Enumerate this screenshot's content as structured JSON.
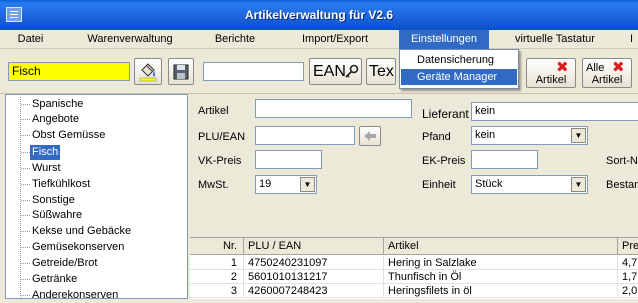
{
  "window": {
    "title": "Artikelverwaltung für V2.6"
  },
  "menu": [
    {
      "label": "Datei"
    },
    {
      "label": "Warenverwaltung"
    },
    {
      "label": "Berichte"
    },
    {
      "label": "Import/Export"
    },
    {
      "label": "Einstellungen"
    },
    {
      "label": "virtuelle Tastatur"
    },
    {
      "label": "I"
    }
  ],
  "dropdown": [
    {
      "label": "Datensicherung"
    },
    {
      "label": "Geräte Manager"
    }
  ],
  "toolbar": {
    "search_value": "Fisch",
    "ean_label": "EAN",
    "text_label": "Tex",
    "delete_article_label": "Artikel",
    "delete_all_label_1": "Alle",
    "delete_all_label_2": "Artikel"
  },
  "tree": {
    "items": [
      {
        "label": "Spanische"
      },
      {
        "label": "Angebote"
      },
      {
        "label": "Obst Gemüsse"
      },
      {
        "label": "Fisch"
      },
      {
        "label": "Wurst"
      },
      {
        "label": "Tiefkühlkost"
      },
      {
        "label": "Sonstige"
      },
      {
        "label": "Süßwahre"
      },
      {
        "label": "Kekse und Gebäcke"
      },
      {
        "label": "Gemüsekonserven"
      },
      {
        "label": "Getreide/Brot"
      },
      {
        "label": "Getränke"
      },
      {
        "label": "Anderekonserven"
      }
    ]
  },
  "form": {
    "artikel_label": "Artikel",
    "artikel_value": "",
    "plu_label": "PLU/EAN",
    "vk_label": "VK-Preis",
    "mwst_label": "MwSt.",
    "mwst_value": "19",
    "lieferant_label": "Lieferant",
    "lieferant_value": "kein",
    "pfand_label": "Pfand",
    "pfand_value": "kein",
    "ek_label": "EK-Preis",
    "einheit_label": "Einheit",
    "einheit_value": "Stück",
    "sort_label": "Sort-N",
    "bestand_label": "Bestan"
  },
  "grid": {
    "headers": [
      "Nr.",
      "PLU / EAN",
      "Artikel",
      "Pre"
    ],
    "rows": [
      {
        "nr": "1",
        "plu": "4750240231097",
        "artikel": "Hering in Salzlake",
        "preis": "4,7"
      },
      {
        "nr": "2",
        "plu": "5601010131217",
        "artikel": "Thunfisch in Öl",
        "preis": "1,7"
      },
      {
        "nr": "3",
        "plu": "4260007248423",
        "artikel": "Heringsfilets in öl",
        "preis": "2,0"
      }
    ]
  },
  "colors": {
    "title_bar": "#1f68e0",
    "highlight": "#316ac5",
    "search_bg": "#ffff00",
    "delete_x": "#d61e1e"
  }
}
